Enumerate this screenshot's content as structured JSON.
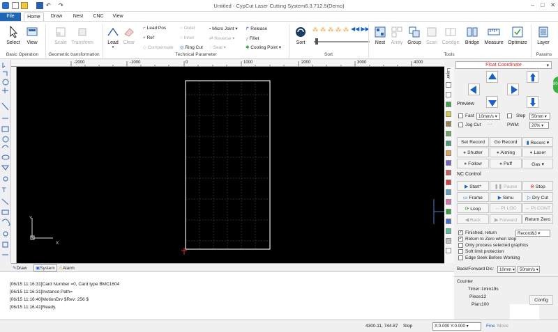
{
  "app": {
    "title": "Untitled - CypCut Laser Cutting System6.3.712.5(Demo)"
  },
  "tabs": [
    {
      "label": "File"
    },
    {
      "label": "Home"
    },
    {
      "label": "Draw"
    },
    {
      "label": "Nest"
    },
    {
      "label": "CNC"
    },
    {
      "label": "View"
    }
  ],
  "ribbon": {
    "basic": {
      "select": "Select",
      "view": "View",
      "group": "Basic Operation"
    },
    "geo": {
      "scale": "Scale",
      "transform": "Transform",
      "group": "Geometric transformation"
    },
    "tech": {
      "lead": "Lead",
      "clear": "Clear",
      "lead_pos": "Lead Pos",
      "ref": "Ref",
      "compensate": "Compensate",
      "outer": "Outer",
      "inner": "Inner",
      "ring_cut": "Ring Cut",
      "micro_joint": "Micro Joint",
      "reverse": "Reverse",
      "seal": "Seal",
      "release": "Release",
      "fillet": "Fillet",
      "cooling_point": "Cooling Point",
      "group": "Technical Parameter"
    },
    "sort": {
      "sort": "Sort",
      "group": "Sort"
    },
    "tools": {
      "nest": "Nest",
      "array": "Array",
      "group_btn": "Group",
      "scan": "Scan",
      "coedge": "Coedge",
      "bridge": "Bridge",
      "measure": "Measure",
      "optimize": "Optimize",
      "group": "Tools"
    },
    "params": {
      "layer": "Layer",
      "group": "Params"
    }
  },
  "ruler": {
    "labels": [
      "-2000",
      "-1000",
      "0",
      "1000",
      "2000",
      "3000",
      "4000"
    ]
  },
  "canvas": {
    "axis_y": "Y",
    "axis_x": "X"
  },
  "layer_strip": {
    "label": "Layer"
  },
  "panel": {
    "coord_mode": "Float Coordinate",
    "preview": "Preview",
    "fast": "Fast",
    "fast_speed": "10mm/s",
    "step": "Step",
    "step_val": "50mm",
    "jog_cut": "Jog Cut",
    "jog_dots": "···",
    "pwm": "PWM:",
    "pwm_val": "20%",
    "set_record": "Set Record",
    "go_record": "Go Record",
    "record": "Recorc",
    "shutter": "Shutter",
    "aiming": "Aiming",
    "laser": "Laser",
    "follow": "Follow",
    "puff": "Puff",
    "gas": "Gas",
    "nc_control": "NC Control",
    "start": "Start*",
    "pause": "Pause",
    "stop": "Stop",
    "frame": "Frame",
    "simu": "Simu",
    "dry_cut": "Dry Cut",
    "loop": "Loop",
    "pt_loc": "Pt LOC",
    "pt_cont": "Pt CONT",
    "back": "Back",
    "forward": "Forward",
    "return_zero": "Return Zero",
    "finished_return": "Finished, return",
    "finished_target": "Record&3",
    "return_zero_stop": "Return to Zero when stop",
    "only_selected": "Only process selected graphics",
    "soft_limit": "Soft limit protection",
    "edge_seek": "Edge Seek Before Working",
    "bf_dis": "Back/Forward Dis:",
    "bf_dis_val": "10mm",
    "bf_speed_val": "50mm/s",
    "counter": "Counter",
    "timer_label": "Timer:",
    "timer_val": "1min19s",
    "piece_label": "Piece:",
    "piece_val": "12",
    "plan_label": "Plan:",
    "plan_val": "100",
    "config": "Config",
    "green_badge": "80"
  },
  "bottom_tabs": [
    "Draw",
    "System",
    "Alarm"
  ],
  "log": [
    "[06/15 11:16:31]Card Number =0, Card type BMC1604",
    "[06/15 11:16:31]Instance Path=",
    "[06/15 11:16:40]MotionDrv $Rev: 256 $",
    "[06/15 11:16:41]Ready."
  ],
  "status": {
    "coords": "4300.11, 744.87",
    "state": "Stop",
    "xy": "X:0.000 Y:0.000",
    "fine": "Fine",
    "move": "Move"
  },
  "colors": {
    "accent": "#1f66b5",
    "canvas": "#000000",
    "red": "#e02020",
    "blue_arrow": "#1a5fc8"
  }
}
